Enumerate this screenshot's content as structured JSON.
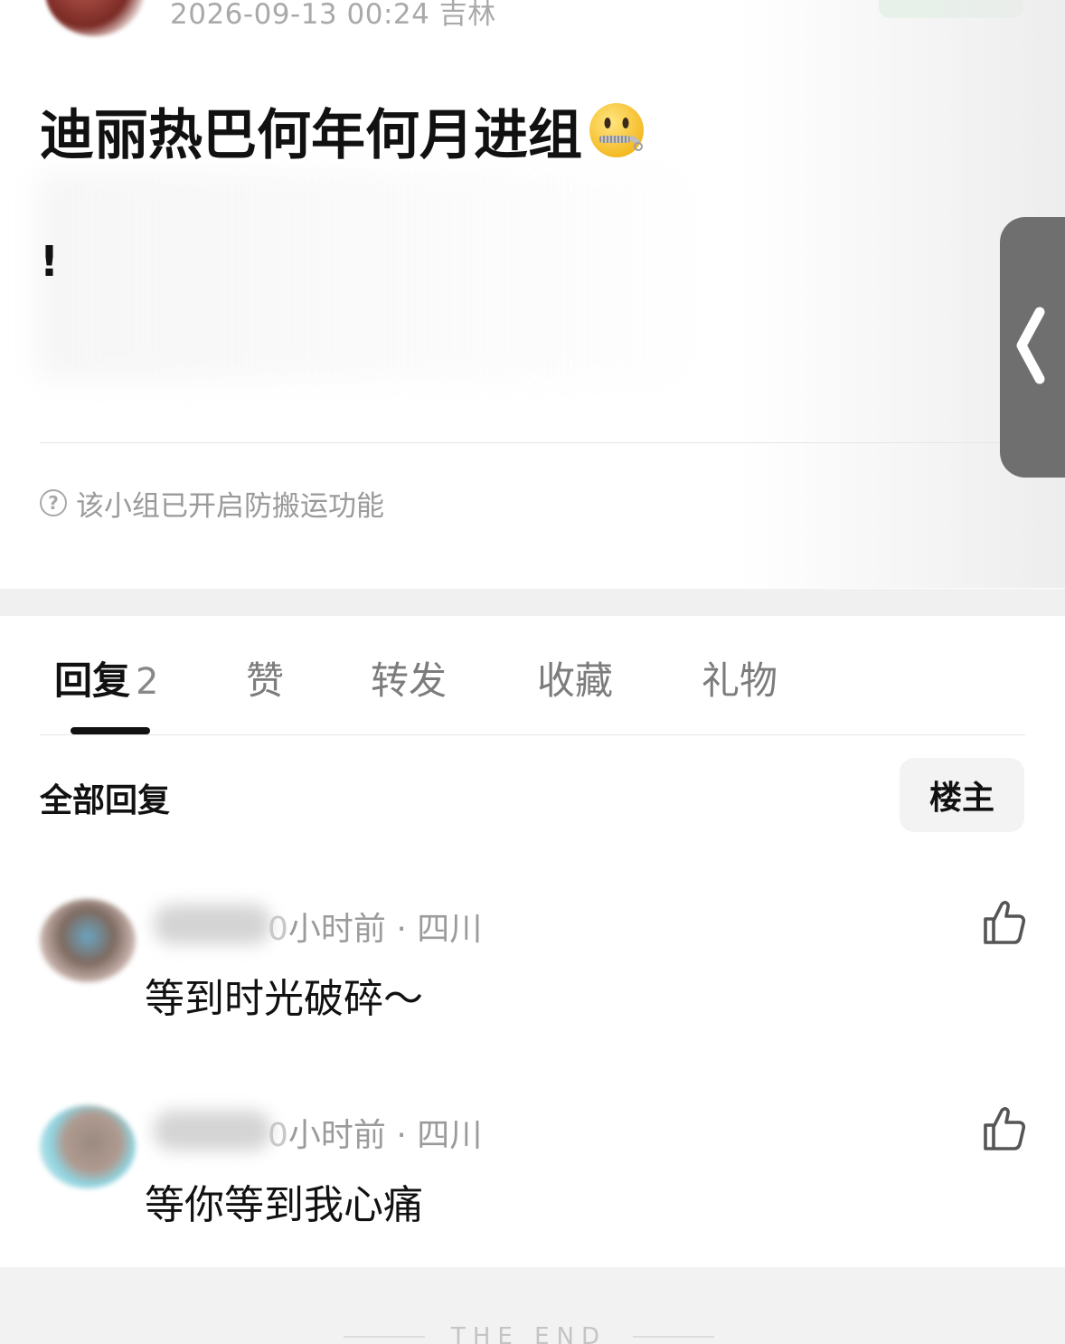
{
  "post": {
    "meta": "2026-09-13 00:24  吉林",
    "title": "迪丽热巴何年何月进组",
    "body": "!",
    "notice": "该小组已开启防搬运功能"
  },
  "tabs": [
    {
      "label": "回复",
      "count": "2",
      "active": true
    },
    {
      "label": "赞"
    },
    {
      "label": "转发"
    },
    {
      "label": "收藏"
    },
    {
      "label": "礼物"
    }
  ],
  "replies": {
    "title": "全部回复",
    "filter_label": "楼主",
    "items": [
      {
        "meta": "小时前 · 四川",
        "text": "等到时光破碎～",
        "prefix_visible": "0"
      },
      {
        "meta": "小时前 · 四川",
        "text": "等你等到我心痛",
        "prefix_visible": "0"
      }
    ]
  },
  "footer": {
    "text": "THE END"
  },
  "icons": {
    "help": "question-circle-icon",
    "like": "thumbs-up-icon",
    "handle": "chevron-left-icon",
    "emoji": "zipper-mouth-face-icon"
  },
  "colors": {
    "accent_green": "#e5f5e8",
    "handle_gray": "#6f6f6f",
    "text_gray": "#9b9b9b"
  }
}
